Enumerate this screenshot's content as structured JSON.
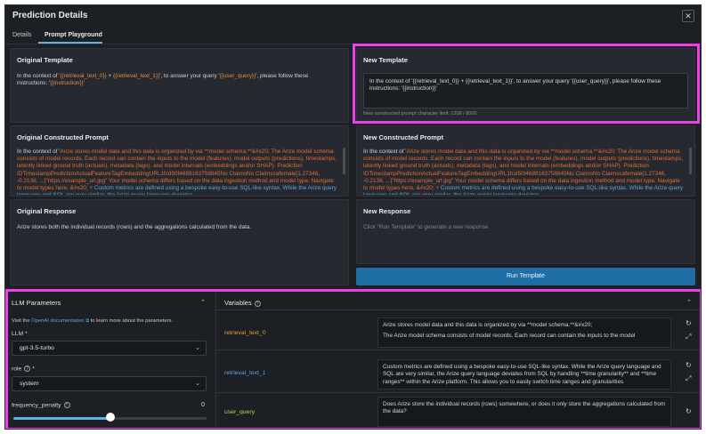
{
  "window": {
    "title": "Prediction Details",
    "close_glyph": "✕"
  },
  "tabs": [
    {
      "label": "Details",
      "active": false
    },
    {
      "label": "Prompt Playground",
      "active": true
    }
  ],
  "original_template": {
    "title": "Original Template",
    "parts": [
      {
        "text": "In the context of ",
        "style": "plain"
      },
      {
        "text": "'{{retrieval_text_0}}",
        "style": "orange"
      },
      {
        "text": " + ",
        "style": "plain"
      },
      {
        "text": "{{retrieval_text_1}}",
        "style": "orange"
      },
      {
        "text": "', to answer your query '",
        "style": "plain"
      },
      {
        "text": "{{user_query}}",
        "style": "orange"
      },
      {
        "text": "', please follow these instructions: '",
        "style": "plain"
      },
      {
        "text": "{{instruction}}",
        "style": "orange"
      },
      {
        "text": "'",
        "style": "plain"
      }
    ]
  },
  "new_template": {
    "title": "New Template",
    "value": "In the context of '{{retrieval_text_0}} + {{retrieval_text_1}}', to answer your query '{{user_query}}', please follow these instructions: '{{instruction}}'",
    "char_limit": "New constructed prompt character limit: 1208 / 8000"
  },
  "original_constructed": {
    "title": "Original Constructed Prompt",
    "lead": "In the context of '",
    "text": "Arize stores model data and this data is organized by via **model schema.**&#x20; The Arize model schema consists of model records. Each record can contain the inputs to the model (features), model outputs (predictions), timestamps, latently linked ground truth (actuals), metadata (tags), and model internals (embeddings and/or SHAP). Prediction IDTimestampPredictionActualFeatureTagEmbeddingURL1fcd50f4689163758845No ClaimsNo Claimsca",
    "text2": "female[1.27346, -0.2138, ...]\"https://example_url.jpg\" Your model schema differs based on the data ingestion method and model type. Navigate to model types here. &#x20; + ",
    "text3": "Custom metrics are defined using a bespoke easy-to-use SQL-like syntax. While the Arize query language and SQL are very similar, the Arize query language deviates"
  },
  "new_constructed": {
    "title": "New Constructed Prompt",
    "lead": "In the context of '",
    "text": "Arize stores model data and this data is organized by via **model schema.**&#x20; The Arize model schema consists of model records. Each record can contain the inputs to the model (features), model outputs (predictions), timestamps, latently linked ground truth (actuals), metadata (tags), and model internals (embeddings and/or SHAP). Prediction IDTimestampPredictionActualFeatureTagEmbeddingURL1fcd50f4689163758845No ClaimsNo Claimsca",
    "text2": "female[1.27346, -0.2138, ...]\"https://example_url.jpg\" Your model schema differs based on the data ingestion method and model type. Navigate to model types here. &#x20; + ",
    "text3": "Custom metrics are defined using a bespoke easy-to-use SQL-like syntax. While the Arize query language and SQL are very similar, the Arize query language deviates"
  },
  "original_response": {
    "title": "Original Response",
    "text": "Arize stores both the individual records (rows) and the aggregations calculated from the data."
  },
  "new_response": {
    "title": "New Response",
    "placeholder": "Click \"Run Template\" to generate a new response"
  },
  "run_button": {
    "label": "Run Template"
  },
  "llm_params": {
    "title": "LLM Parameters",
    "visit_prefix": "Visit the ",
    "visit_link": "OpenAI documentation",
    "visit_suffix": " to learn more about the parameters.",
    "llm_label": "LLM *",
    "llm_value": "gpt-3.5-turbo",
    "role_label": "role",
    "role_required": "*",
    "role_value": "system",
    "freq_label": "frequency_penalty",
    "freq_value": "0",
    "freq_fill_fraction": 0.5
  },
  "variables": {
    "title": "Variables",
    "rows": [
      {
        "name": "retrieval_text_0",
        "line1": "Arize stores model data and this data is organized by via **model schema.**&#x20;",
        "line2": "The Arize model schema consists of model records. Each record can contain the inputs to the model"
      },
      {
        "name": "retrieval_text_1",
        "line1": "Custom metrics are defined using a bespoke easy-to-use SQL-like syntax. While the Arize query language and SQL are very similar, the Arize query language deviates from SQL by handling **time granularity** and **time ranges** within the Arize platform. This allows you to easily switch time ranges and granularities",
        "line2": ""
      },
      {
        "name": "user_query",
        "line1": "Does Arize store the individual records (rows) somewhere, or does it only store the aggregations calculated from the data?",
        "line2": ""
      }
    ]
  },
  "icons": {
    "chevron_up": "⌃",
    "chevron_down": "⌄",
    "refresh": "↻",
    "expand": "⤢",
    "help": "?",
    "external": "⧉"
  },
  "colors": {
    "accent": "#5db3e8",
    "highlight": "#ee3ee8",
    "prompt_orange": "#e66a2c",
    "var_name": "#e0a23a",
    "button": "#1f6fa6"
  }
}
